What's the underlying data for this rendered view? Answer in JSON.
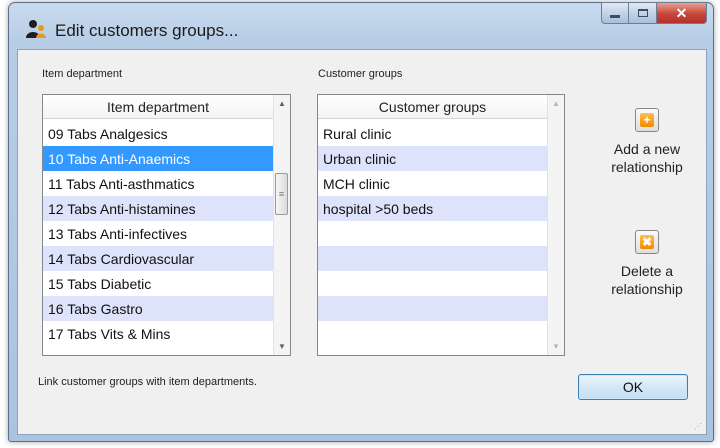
{
  "window": {
    "title": "Edit customers groups...",
    "close_glyph": "✕",
    "icon": "people-icon"
  },
  "left_list": {
    "group_label": "Item department",
    "column_header": "Item department",
    "items": [
      "09 Tabs Analgesics",
      "10 Tabs Anti-Anaemics",
      "11 Tabs Anti-asthmatics",
      "12 Tabs Anti-histamines",
      "13 Tabs Anti-infectives",
      "14 Tabs Cardiovascular",
      "15 Tabs Diabetic",
      "16 Tabs Gastro",
      "17 Tabs Vits & Mins"
    ],
    "selected_item": "10 Tabs Anti-Anaemics"
  },
  "right_list": {
    "group_label": "Customer groups",
    "column_header": "Customer groups",
    "items": [
      "Rural clinic",
      "Urban clinic",
      "MCH clinic",
      "hospital >50 beds",
      "",
      "",
      "",
      "",
      ""
    ]
  },
  "actions": {
    "add_label_1": "Add a new",
    "add_label_2": "relationship",
    "add_icon": "add-plus-icon",
    "delete_label_1": "Delete a",
    "delete_label_2": "relationship",
    "delete_icon": "delete-x-icon"
  },
  "footer": {
    "hint": "Link customer groups with item departments.",
    "ok_label": "OK"
  }
}
